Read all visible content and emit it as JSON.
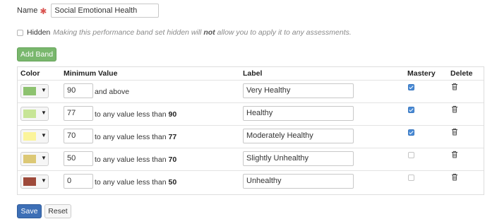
{
  "form": {
    "name_label": "Name",
    "required_mark": "✱",
    "name_value": "Social Emotional Health",
    "hidden_label": "Hidden",
    "hidden_note_pre": "Making this performance band set hidden will ",
    "hidden_note_bold": "not",
    "hidden_note_post": " allow you to apply it to any assessments.",
    "hidden_checked": false,
    "add_band_label": "Add Band"
  },
  "table": {
    "headers": {
      "color": "Color",
      "min_value": "Minimum Value",
      "label": "Label",
      "mastery": "Mastery",
      "delete": "Delete"
    },
    "rows": [
      {
        "color": "#8dc26f",
        "min": "90",
        "text_pre": "and above",
        "text_bold": "",
        "label": "Very Healthy",
        "mastery": true
      },
      {
        "color": "#c7e596",
        "min": "77",
        "text_pre": "to any value less than ",
        "text_bold": "90",
        "label": "Healthy",
        "mastery": true
      },
      {
        "color": "#fbf49b",
        "min": "70",
        "text_pre": "to any value less than ",
        "text_bold": "77",
        "label": "Moderately Healthy",
        "mastery": true
      },
      {
        "color": "#dcc875",
        "min": "50",
        "text_pre": "to any value less than ",
        "text_bold": "70",
        "label": "Slightly Unhealthy",
        "mastery": false
      },
      {
        "color": "#9e4a3a",
        "min": "0",
        "text_pre": "to any value less than ",
        "text_bold": "50",
        "label": "Unhealthy",
        "mastery": false
      }
    ],
    "caret": "▼",
    "delete_icon": "trash-icon"
  },
  "actions": {
    "save_label": "Save",
    "reset_label": "Reset"
  },
  "colors": {
    "add_band": "#79b76d",
    "save": "#3d6fb6",
    "mastery_checked": "#4a8bd6"
  }
}
